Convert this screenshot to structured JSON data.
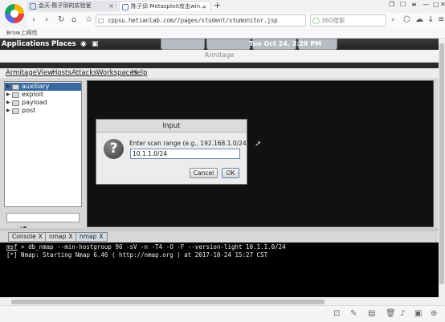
{
  "browser": {
    "tabs": [
      {
        "label": "会天-陈子邱的实验室"
      },
      {
        "label": "陈子邱-Metasploit攻击win..."
      }
    ],
    "url": "cppsu.hetianlab.com//pages/student/stumonitor.jsp",
    "search_placeholder": "360搜索",
    "bookmark": "Brow上网信"
  },
  "desktop": {
    "panel": {
      "applications": "Applications",
      "places": "Places",
      "clock": "Tue Oct 24, 3:28 PM"
    }
  },
  "armitage": {
    "window_title": "Armitage",
    "menu": [
      "Armitage",
      "View",
      "Hosts",
      "Attacks",
      "Workspaces",
      "Help"
    ],
    "tree": [
      "auxiliary",
      "exploit",
      "payload",
      "post"
    ],
    "console_tabs": [
      {
        "label": "Console",
        "close": "X"
      },
      {
        "label": "nmap",
        "close": "X"
      },
      {
        "label": "nmap",
        "close": "X"
      }
    ],
    "console": {
      "prompt": "msf",
      "command": " > db_nmap --min-hostgroup 96 -sV -n -T4 -O -F --version-light 10.1.1.0/24",
      "output": "[*] Nmap: Starting Nmap 6.46 ( http://nmap.org ) at 2017-10-24 15:27 CST"
    }
  },
  "dialog": {
    "title": "Input",
    "prompt": "Enter scan range (e.g., 192.168.1.0/24):",
    "value": "10.1.1.0/24",
    "cancel": "Cancel",
    "ok": "OK"
  }
}
